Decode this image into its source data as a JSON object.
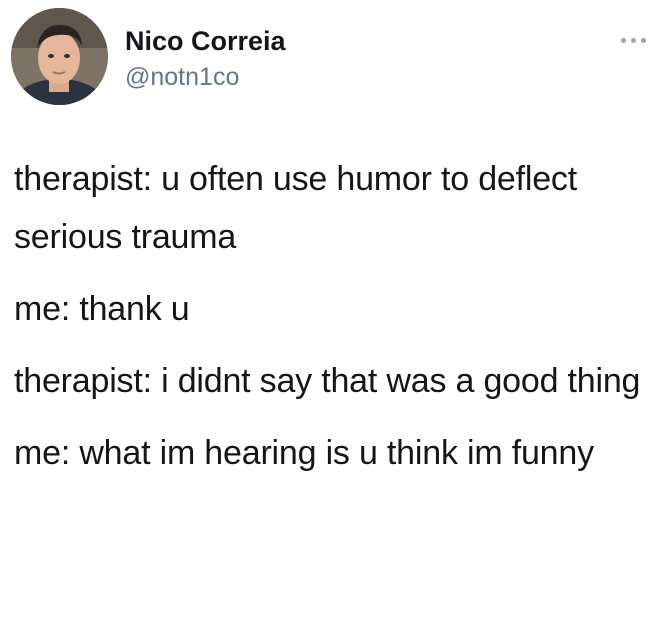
{
  "author": {
    "display_name": "Nico Correia",
    "handle": "@notn1co"
  },
  "actions": {
    "more_icon": "more-horizontal-icon"
  },
  "tweet": {
    "lines": [
      "therapist: u often use humor to deflect serious trauma",
      "me: thank u",
      "therapist: i didnt say that was a good thing",
      "me: what im hearing is u think im funny"
    ]
  }
}
